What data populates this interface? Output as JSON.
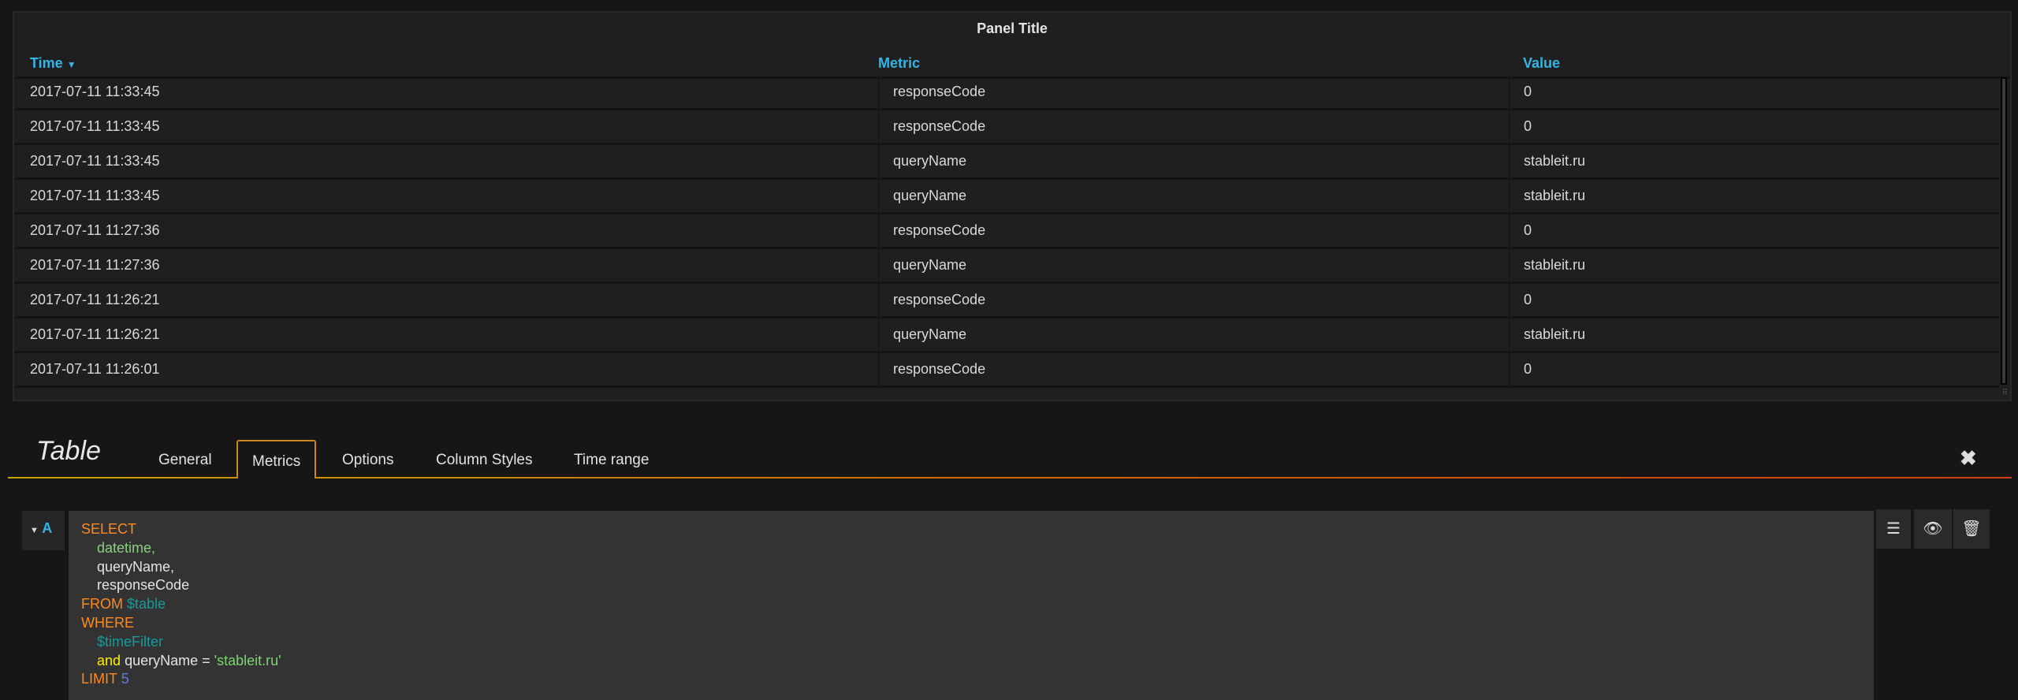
{
  "panel": {
    "title": "Panel Title",
    "columns": [
      "Time",
      "Metric",
      "Value"
    ],
    "sort_icon": "caret-down-icon",
    "rows": [
      [
        "2017-07-11 11:33:45",
        "responseCode",
        "0"
      ],
      [
        "2017-07-11 11:33:45",
        "responseCode",
        "0"
      ],
      [
        "2017-07-11 11:33:45",
        "queryName",
        "stableit.ru"
      ],
      [
        "2017-07-11 11:33:45",
        "queryName",
        "stableit.ru"
      ],
      [
        "2017-07-11 11:27:36",
        "responseCode",
        "0"
      ],
      [
        "2017-07-11 11:27:36",
        "queryName",
        "stableit.ru"
      ],
      [
        "2017-07-11 11:26:21",
        "responseCode",
        "0"
      ],
      [
        "2017-07-11 11:26:21",
        "queryName",
        "stableit.ru"
      ],
      [
        "2017-07-11 11:26:01",
        "responseCode",
        "0"
      ]
    ]
  },
  "editor": {
    "title": "Table",
    "tabs": [
      "General",
      "Metrics",
      "Options",
      "Column Styles",
      "Time range"
    ],
    "active_tab": "Metrics",
    "close": "✖",
    "query": {
      "ref": "A",
      "lines": {
        "select": "SELECT",
        "f1": "datetime,",
        "f2": "queryName,",
        "f3": "responseCode",
        "from": "FROM",
        "table": "$table",
        "where": "WHERE",
        "filter": "$timeFilter",
        "and": "and",
        "cond": "queryName =",
        "str": "'stableit.ru'",
        "limit": "LIMIT",
        "n": "5"
      }
    },
    "buttons": [
      "menu-icon",
      "eye-icon",
      "trash-icon"
    ]
  }
}
